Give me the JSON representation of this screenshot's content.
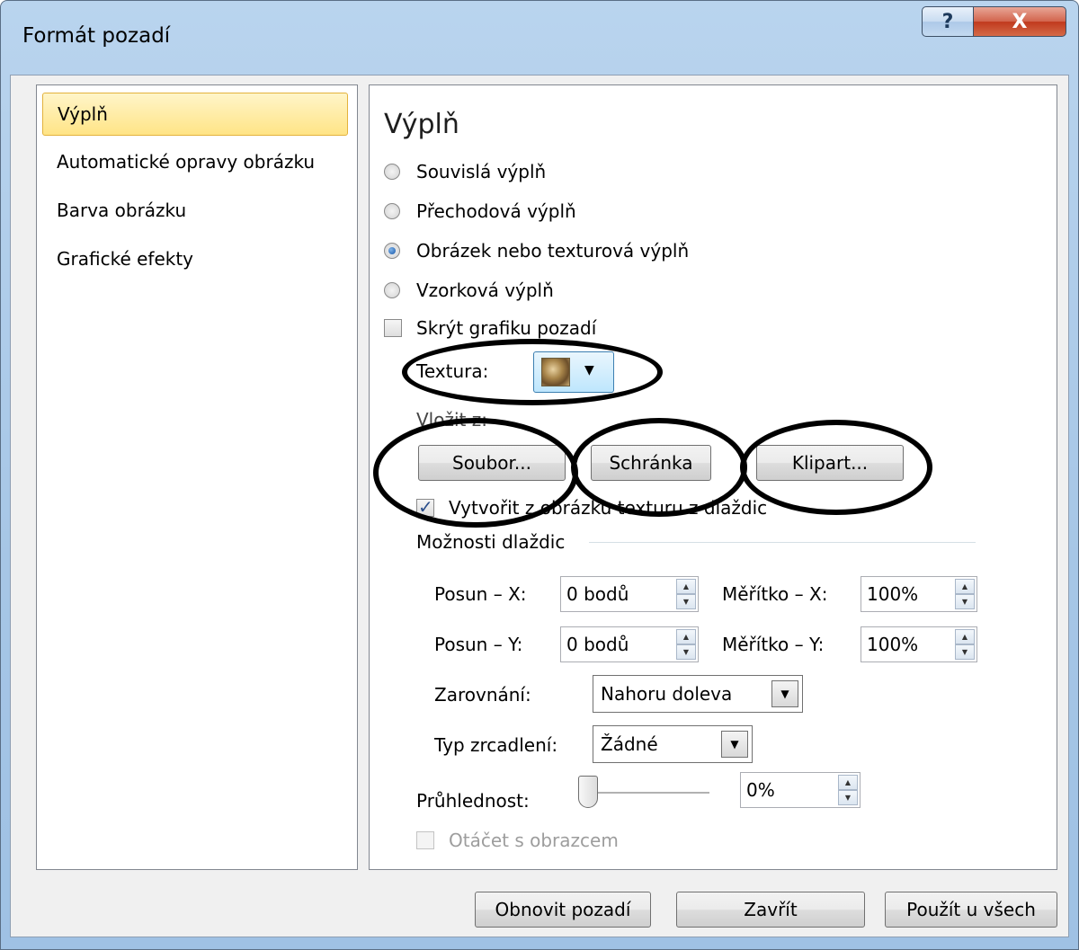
{
  "window": {
    "title": "Formát pozadí",
    "help_glyph": "?",
    "close_glyph": "X"
  },
  "nav": {
    "items": [
      {
        "label": "Výplň",
        "selected": true
      },
      {
        "label": "Automatické opravy obrázku",
        "selected": false
      },
      {
        "label": "Barva obrázku",
        "selected": false
      },
      {
        "label": "Grafické efekty",
        "selected": false
      }
    ]
  },
  "fill": {
    "heading": "Výplň",
    "options": [
      {
        "label": "Souvislá výplň",
        "checked": false
      },
      {
        "label": "Přechodová výplň",
        "checked": false
      },
      {
        "label": "Obrázek nebo texturová výplň",
        "checked": true
      },
      {
        "label": "Vzorková výplň",
        "checked": false
      }
    ],
    "hide_background_graphics": {
      "label": "Skrýt grafiku pozadí",
      "checked": false
    },
    "texture_label": "Textura:",
    "insert_from_label": "Vložit z:",
    "buttons": {
      "file": "Soubor...",
      "clipboard": "Schránka",
      "clipart": "Klipart..."
    },
    "tile_checkbox": {
      "label": "Vytvořit z obrázku texturu z dlaždic",
      "checked": true
    },
    "tiling_options_label": "Možnosti dlaždic",
    "offset_x": {
      "label": "Posun – X:",
      "value": "0 bodů"
    },
    "offset_y": {
      "label": "Posun – Y:",
      "value": "0 bodů"
    },
    "scale_x": {
      "label": "Měřítko – X:",
      "value": "100%"
    },
    "scale_y": {
      "label": "Měřítko – Y:",
      "value": "100%"
    },
    "alignment": {
      "label": "Zarovnání:",
      "value": "Nahoru doleva"
    },
    "mirror_type": {
      "label": "Typ zrcadlení:",
      "value": "Žádné"
    },
    "transparency": {
      "label": "Průhlednost:",
      "value": "0%",
      "level": 0
    },
    "rotate_with_shape": {
      "label": "Otáčet s obrazcem",
      "checked": false,
      "disabled": true
    }
  },
  "footer": {
    "reset": "Obnovit pozadí",
    "close": "Zavřít",
    "apply_all": "Použít u všech"
  }
}
